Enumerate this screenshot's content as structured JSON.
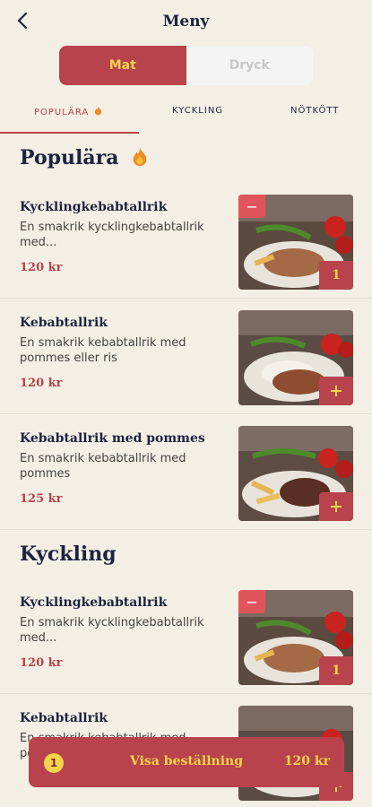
{
  "header": {
    "title": "Meny"
  },
  "segment": {
    "food": "Mat",
    "drink": "Dryck"
  },
  "tabs": [
    {
      "label": "POPULÄRA"
    },
    {
      "label": "KYCKLING"
    },
    {
      "label": "NÖTKÖTT"
    }
  ],
  "sections": [
    {
      "title": "Populära",
      "items": [
        {
          "name": "Kycklingkebabtallrik",
          "desc": "En smakrik kycklingkebabtallrik med...",
          "price": "120 kr",
          "qty": "1"
        },
        {
          "name": "Kebabtallrik",
          "desc": "En smakrik kebabtallrik med pommes eller ris",
          "price": "120 kr"
        },
        {
          "name": "Kebabtallrik med pommes",
          "desc": "En smakrik kebabtallrik med pommes",
          "price": "125 kr"
        }
      ]
    },
    {
      "title": "Kyckling",
      "items": [
        {
          "name": "Kycklingkebabtallrik",
          "desc": "En smakrik kycklingkebabtallrik med...",
          "price": "120 kr",
          "qty": "1"
        },
        {
          "name": "Kebabtallrik",
          "desc": "En smakrik kebabtallrik med pommes eller ris",
          "price": ""
        }
      ]
    }
  ],
  "order_bar": {
    "count": "1",
    "label": "Visa beställning",
    "total": "120 kr"
  },
  "colors": {
    "accent": "#b9434c",
    "highlight": "#f3d34a",
    "background": "#f3efe4"
  }
}
